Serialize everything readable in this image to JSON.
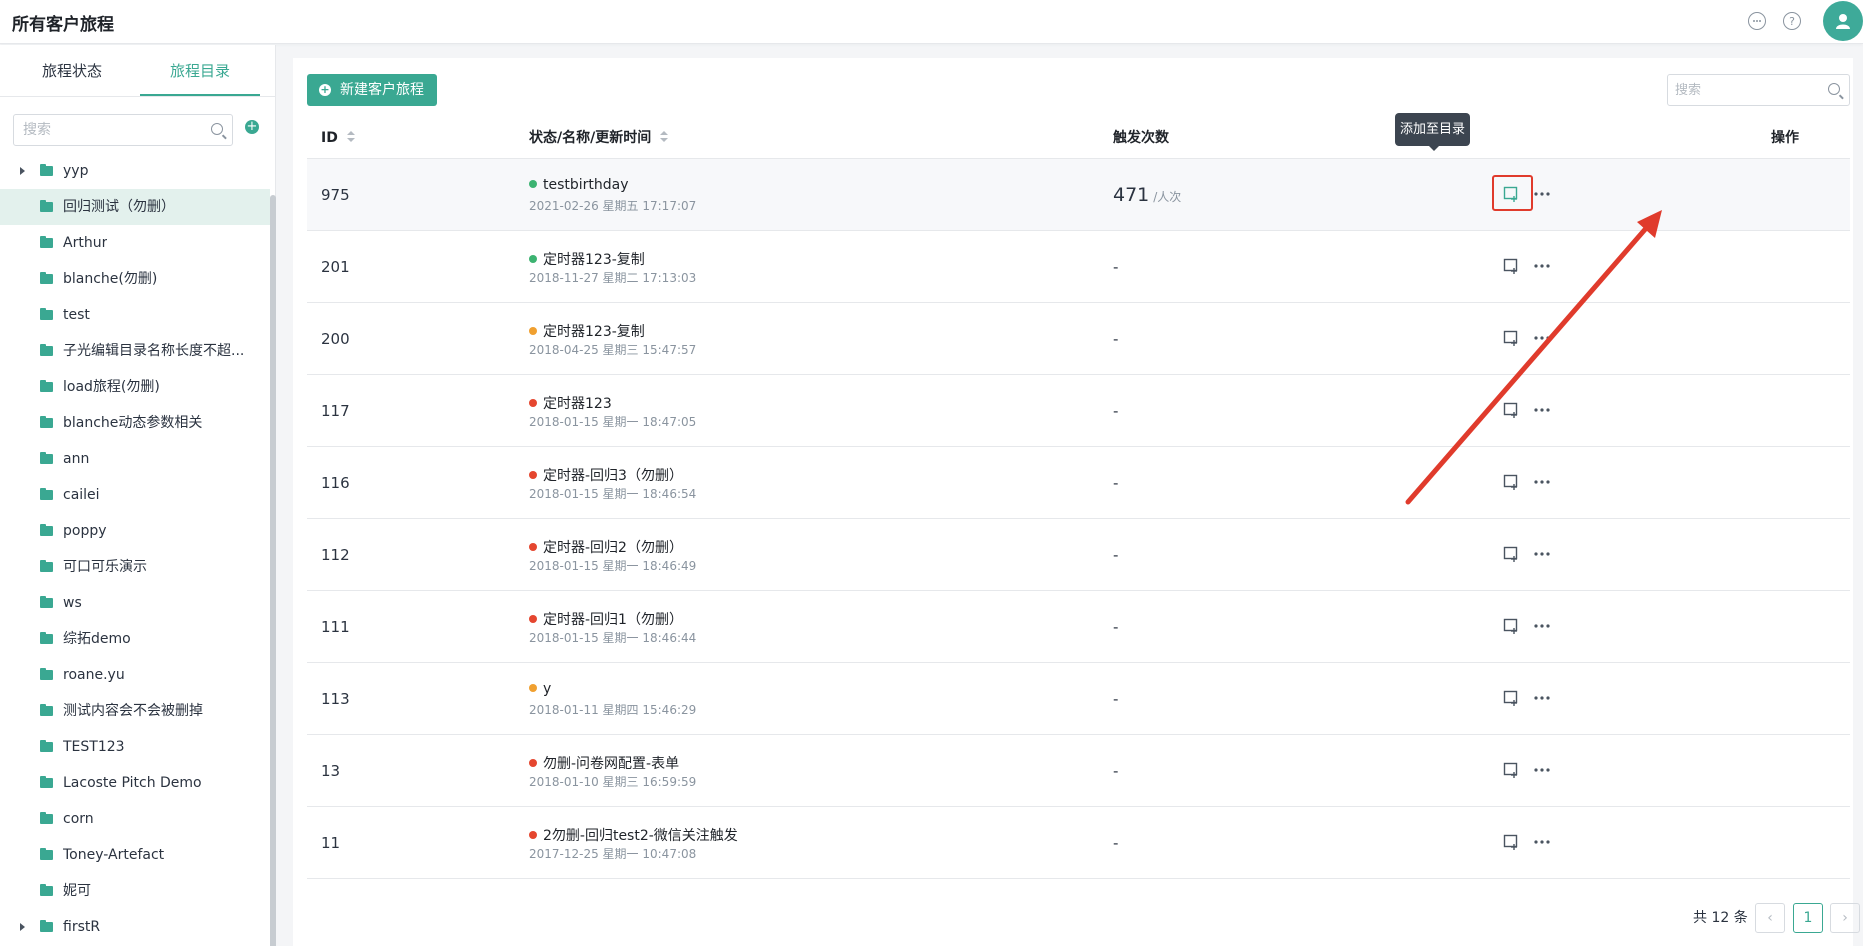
{
  "header": {
    "title": "所有客户旅程"
  },
  "sidebar": {
    "tabs": [
      {
        "label": "旅程状态"
      },
      {
        "label": "旅程目录"
      }
    ],
    "search": {
      "placeholder": "搜索"
    },
    "tree": [
      {
        "label": "yyp",
        "expandable": true
      },
      {
        "label": "回归测试（勿删）",
        "selected": true
      },
      {
        "label": "Arthur"
      },
      {
        "label": "blanche(勿删)"
      },
      {
        "label": "test"
      },
      {
        "label": "子光编辑目录名称长度不超..."
      },
      {
        "label": "load旅程(勿删)"
      },
      {
        "label": "blanche动态参数相关"
      },
      {
        "label": "ann"
      },
      {
        "label": "cailei"
      },
      {
        "label": "poppy"
      },
      {
        "label": "可口可乐演示"
      },
      {
        "label": "ws"
      },
      {
        "label": "综拓demo"
      },
      {
        "label": "roane.yu"
      },
      {
        "label": "测试内容会不会被删掉"
      },
      {
        "label": "TEST123"
      },
      {
        "label": "Lacoste Pitch Demo"
      },
      {
        "label": "corn"
      },
      {
        "label": "Toney-Artefact"
      },
      {
        "label": "妮可"
      },
      {
        "label": "firstR",
        "expandable": true
      }
    ]
  },
  "main": {
    "new_button_label": "新建客户旅程",
    "search": {
      "placeholder": "搜索"
    },
    "columns": {
      "id": "ID",
      "name": "状态/名称/更新时间",
      "count": "触发次数",
      "ops": "操作"
    },
    "tooltip": "添加至目录",
    "rows": [
      {
        "id": "975",
        "status": "green",
        "name": "testbirthday",
        "time": "2021-02-26 星期五 17:17:07",
        "count": "471",
        "unit": "/人次"
      },
      {
        "id": "201",
        "status": "green",
        "name": "定时器123-复制",
        "time": "2018-11-27 星期二 17:13:03",
        "count": "-",
        "unit": ""
      },
      {
        "id": "200",
        "status": "orange",
        "name": "定时器123-复制",
        "time": "2018-04-25 星期三 15:47:57",
        "count": "-",
        "unit": ""
      },
      {
        "id": "117",
        "status": "red",
        "name": "定时器123",
        "time": "2018-01-15 星期一 18:47:05",
        "count": "-",
        "unit": ""
      },
      {
        "id": "116",
        "status": "red",
        "name": "定时器-回归3（勿删）",
        "time": "2018-01-15 星期一 18:46:54",
        "count": "-",
        "unit": ""
      },
      {
        "id": "112",
        "status": "red",
        "name": "定时器-回归2（勿删）",
        "time": "2018-01-15 星期一 18:46:49",
        "count": "-",
        "unit": ""
      },
      {
        "id": "111",
        "status": "red",
        "name": "定时器-回归1（勿删）",
        "time": "2018-01-15 星期一 18:46:44",
        "count": "-",
        "unit": ""
      },
      {
        "id": "113",
        "status": "orange",
        "name": "y",
        "time": "2018-01-11 星期四 15:46:29",
        "count": "-",
        "unit": ""
      },
      {
        "id": "13",
        "status": "red",
        "name": "勿删-问卷网配置-表单",
        "time": "2018-01-10 星期三 16:59:59",
        "count": "-",
        "unit": ""
      },
      {
        "id": "11",
        "status": "red",
        "name": "2勿删-回归test2-微信关注触发",
        "time": "2017-12-25 星期一 10:47:08",
        "count": "-",
        "unit": ""
      }
    ],
    "pagination": {
      "total_label": "共 12 条",
      "current_page": "1",
      "prev": "‹",
      "next": "›"
    }
  },
  "colors": {
    "accent": "#3aa892",
    "status_green": "#3cb371",
    "status_orange": "#f0a030",
    "status_red": "#e5462f",
    "annotation_red": "#e03b2c"
  }
}
